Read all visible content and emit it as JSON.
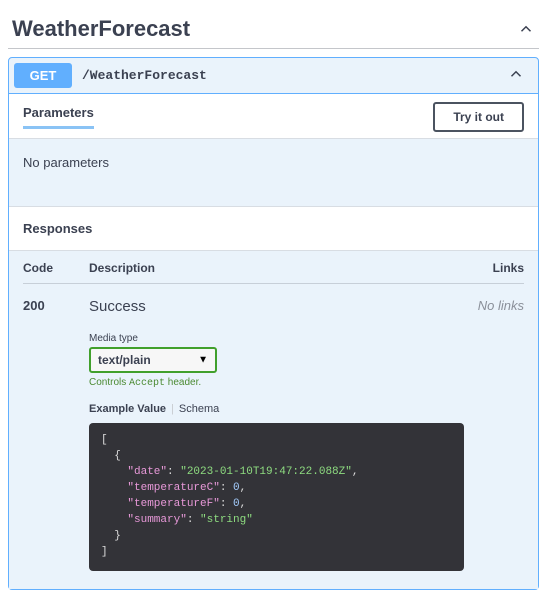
{
  "tag": {
    "name": "WeatherForecast"
  },
  "operation": {
    "method": "GET",
    "path": "/WeatherForecast",
    "parameters_tab": "Parameters",
    "try_it_out": "Try it out",
    "no_parameters": "No parameters",
    "responses_header": "Responses",
    "columns": {
      "code": "Code",
      "description": "Description",
      "links": "Links"
    },
    "response": {
      "code": "200",
      "description": "Success",
      "links": "No links",
      "media_type_label": "Media type",
      "media_type_value": "text/plain",
      "controls_prefix": "Controls ",
      "controls_accept": "Accept",
      "controls_suffix": " header.",
      "example_tab": "Example Value",
      "schema_tab": "Schema",
      "example": {
        "date_key": "\"date\"",
        "date_val": "\"2023-01-10T19:47:22.088Z\"",
        "tc_key": "\"temperatureC\"",
        "tc_val": "0",
        "tf_key": "\"temperatureF\"",
        "tf_val": "0",
        "sum_key": "\"summary\"",
        "sum_val": "\"string\""
      }
    }
  }
}
